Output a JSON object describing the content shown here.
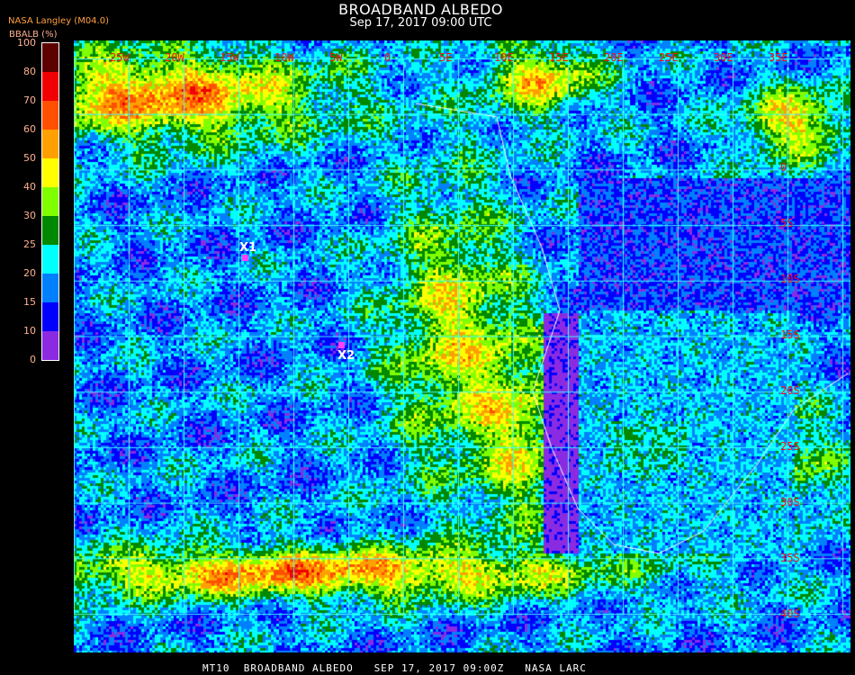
{
  "header": {
    "title": "BROADBAND ALBEDO",
    "subtitle": "Sep 17, 2017 09:00 UTC",
    "source": "NASA Langley (M04.0)"
  },
  "colorbar": {
    "label": "BBALB (%)",
    "ticks": [
      "100",
      "80",
      "70",
      "60",
      "50",
      "40",
      "30",
      "25",
      "20",
      "15",
      "10",
      "0"
    ],
    "colors": [
      "#5c0000",
      "#f00000",
      "#ff5000",
      "#ffa000",
      "#ffff00",
      "#80ff00",
      "#008800",
      "#00ffff",
      "#0080ff",
      "#0000ff",
      "#8a2be2"
    ]
  },
  "map": {
    "lon_labels": [
      "25W",
      "20W",
      "15W",
      "10W",
      "5W",
      "0",
      "5E",
      "10E",
      "15E",
      "20E",
      "25E",
      "30E",
      "35E"
    ],
    "lat_labels": [
      "0",
      "5S",
      "10S",
      "15S",
      "20S",
      "25S",
      "30S",
      "35S",
      "40S"
    ],
    "grid_color": "#40ffff",
    "markers": [
      {
        "label": "X1"
      },
      {
        "label": "X2"
      }
    ],
    "marker_color": "#ff40ff"
  },
  "footer": {
    "text": "MT10  BROADBAND ALBEDO   SEP 17, 2017 09:00Z   NASA LARC"
  }
}
